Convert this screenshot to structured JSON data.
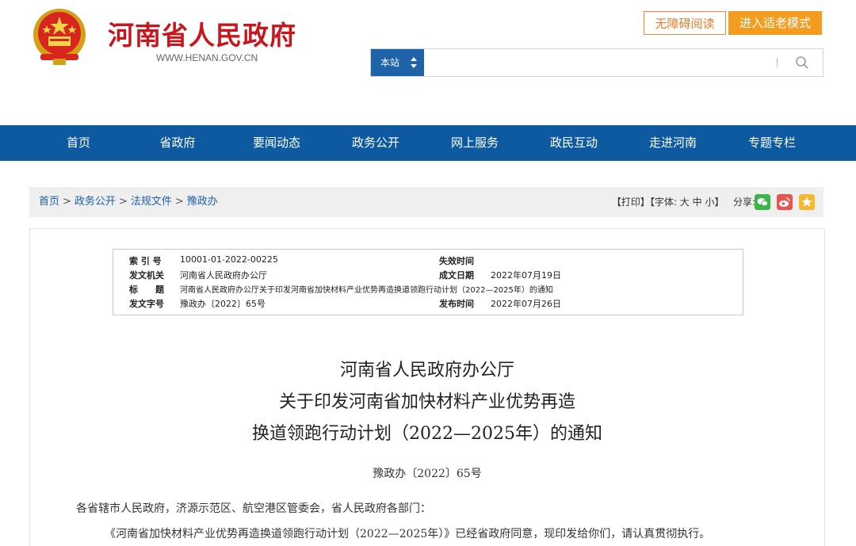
{
  "header": {
    "site_title": "河南省人民政府",
    "site_url": "WWW.HENAN.GOV.CN",
    "accessibility_label": "无障碍阅读",
    "elder_mode_label": "进入适老模式",
    "search_scope": "本站",
    "search_value": ""
  },
  "nav": {
    "items": [
      "首页",
      "省政府",
      "要闻动态",
      "政务公开",
      "网上服务",
      "政民互动",
      "走进河南",
      "专题专栏"
    ]
  },
  "breadcrumb": {
    "items": [
      "首页",
      "政务公开",
      "法规文件",
      "豫政办"
    ],
    "separator": ">"
  },
  "tools": {
    "print": "【打印】",
    "font_label": "【字体:",
    "font_large": "大",
    "font_medium": "中",
    "font_small": "小",
    "font_close": "】",
    "share_label": "分享:",
    "share_icons": [
      "wechat-icon",
      "weibo-icon",
      "qzone-icon"
    ]
  },
  "meta": {
    "index_label": "索 引 号",
    "index_value": "10001-01-2022-00225",
    "expire_label": "失效时间",
    "expire_value": "",
    "issuer_label": "发文机关",
    "issuer_value": "河南省人民政府办公厅",
    "written_label": "成文日期",
    "written_value": "2022年07月19日",
    "title_label": "标　　题",
    "title_value": "河南省人民政府办公厅关于印发河南省加快材料产业优势再造换道领跑行动计划（2022—2025年）的通知",
    "docno_label": "发文字号",
    "docno_value": "豫政办〔2022〕65号",
    "publish_label": "发布时间",
    "publish_value": "2022年07月26日"
  },
  "document": {
    "title_line1": "河南省人民政府办公厅",
    "title_line2": "关于印发河南省加快材料产业优势再造",
    "title_line3": "换道领跑行动计划（2022—2025年）的通知",
    "doc_number": "豫政办〔2022〕65号",
    "salutation": "各省辖市人民政府，济源示范区、航空港区管委会，省人民政府各部门：",
    "body_line1": "《河南省加快材料产业优势再造换道领跑行动计划（2022—2025年）》已经省政府同意，现印发给你们，请认真贯彻执行。"
  },
  "colors": {
    "brand_red": "#c8161d",
    "nav_blue": "#0e5aa0",
    "orange": "#f39c20"
  }
}
